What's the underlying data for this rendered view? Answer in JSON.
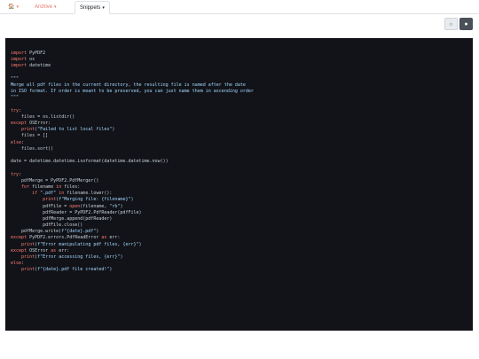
{
  "nav": {
    "home_icon": "home-icon",
    "tabs": [
      {
        "label": "",
        "icon": "home-icon",
        "has_caret": true
      },
      {
        "label": "Archive",
        "has_caret": true
      },
      {
        "label": "Snippets",
        "has_caret": true,
        "active": true
      }
    ],
    "caret_glyph": "▾",
    "home_glyph": "🏠"
  },
  "theme_toggle": {
    "light_icon": "sun-icon",
    "dark_icon": "moon-icon",
    "light_glyph": "☼",
    "dark_glyph": "●"
  },
  "code": {
    "colors": {
      "keyword": "#ff7b72",
      "string": "#a5d6ff",
      "function": "#d2a8ff",
      "plain": "#c9d1d9",
      "background": "#111318"
    },
    "lines": [
      [
        [
          "kw",
          "import"
        ],
        [
          "p",
          " PyPDF2"
        ]
      ],
      [
        [
          "kw",
          "import"
        ],
        [
          "p",
          " os"
        ]
      ],
      [
        [
          "kw",
          "import"
        ],
        [
          "p",
          " datetime"
        ]
      ],
      [],
      [
        [
          "c",
          "\"\"\""
        ]
      ],
      [
        [
          "c",
          "Merge all pdf files in the current directory, the resulting file is named after the date"
        ]
      ],
      [
        [
          "c",
          "in ISO format. If order is meant to be preserved, you can just name them in ascending order"
        ]
      ],
      [
        [
          "c",
          "\"\"\""
        ]
      ],
      [],
      [
        [
          "kw",
          "try"
        ],
        [
          "p",
          ":"
        ]
      ],
      [
        [
          "p",
          "    files = os.listdir()"
        ]
      ],
      [
        [
          "kw",
          "except"
        ],
        [
          "p",
          " OSError:"
        ]
      ],
      [
        [
          "p",
          "    "
        ],
        [
          "kw",
          "print"
        ],
        [
          "s",
          "(\"Failed to list local files\")"
        ]
      ],
      [
        [
          "p",
          "    files = []"
        ]
      ],
      [
        [
          "kw",
          "else"
        ],
        [
          "p",
          ":"
        ]
      ],
      [
        [
          "p",
          "    files.sort()"
        ]
      ],
      [],
      [
        [
          "p",
          "date = datetime.datetime.isoformat(datetime.datetime.now())"
        ]
      ],
      [],
      [
        [
          "kw",
          "try"
        ],
        [
          "p",
          ":"
        ]
      ],
      [
        [
          "p",
          "    pdfMerge = PyPDF2.PdfMerger()"
        ]
      ],
      [
        [
          "p",
          "    "
        ],
        [
          "kw",
          "for"
        ],
        [
          "p",
          " filename "
        ],
        [
          "kw",
          "in"
        ],
        [
          "p",
          " files:"
        ]
      ],
      [
        [
          "p",
          "        "
        ],
        [
          "kw",
          "if"
        ],
        [
          "s",
          " \".pdf\""
        ],
        [
          "kw",
          " in"
        ],
        [
          "p",
          " filename.lower():"
        ]
      ],
      [
        [
          "p",
          "            "
        ],
        [
          "kw",
          "print"
        ],
        [
          "s",
          "(f\"Merging file: {filename}\")"
        ]
      ],
      [
        [
          "p",
          "            pdfFile = "
        ],
        [
          "kw",
          "open"
        ],
        [
          "p",
          "(filename, "
        ],
        [
          "s",
          "\"rb\""
        ],
        [
          "p",
          ")"
        ]
      ],
      [
        [
          "p",
          "            pdfReader = PyPDF2.PdfReader(pdfFile)"
        ]
      ],
      [
        [
          "p",
          "            pdfMerge.append(pdfReader)"
        ]
      ],
      [
        [
          "p",
          "            pdfFile.close()"
        ]
      ],
      [
        [
          "p",
          "    pdfMerge.write("
        ],
        [
          "s",
          "f\"{date}.pdf\""
        ],
        [
          "p",
          ")"
        ]
      ],
      [
        [
          "kw",
          "except"
        ],
        [
          "p",
          " PyPDF2.errors.PdfReadError "
        ],
        [
          "kw",
          "as"
        ],
        [
          "p",
          " err:"
        ]
      ],
      [
        [
          "p",
          "    "
        ],
        [
          "kw",
          "print"
        ],
        [
          "s",
          "(f\"Error manipulating pdf files, {err}\")"
        ]
      ],
      [
        [
          "kw",
          "except"
        ],
        [
          "p",
          " OSError "
        ],
        [
          "kw",
          "as"
        ],
        [
          "p",
          " err:"
        ]
      ],
      [
        [
          "p",
          "    "
        ],
        [
          "kw",
          "print"
        ],
        [
          "s",
          "(f\"Error accessing files, {err}\")"
        ]
      ],
      [
        [
          "kw",
          "else"
        ],
        [
          "p",
          ":"
        ]
      ],
      [
        [
          "p",
          "    "
        ],
        [
          "kw",
          "print"
        ],
        [
          "s",
          "(f\"{date}.pdf file created!\")"
        ]
      ]
    ]
  }
}
